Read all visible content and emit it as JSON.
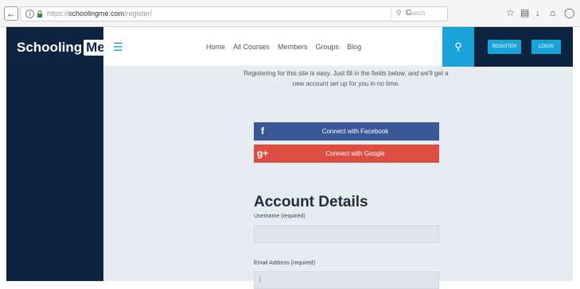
{
  "browser": {
    "back_icon": "back-arrow-icon",
    "url_protocol": "https://",
    "url_host": "schoolingme.com",
    "url_path": "/register/",
    "search_placeholder": "Search",
    "toolbar_icons": [
      "star-icon",
      "clipboard-icon",
      "download-icon",
      "home-icon",
      "shield-icon"
    ]
  },
  "site": {
    "logo_text": "Schooling",
    "logo_badge": "Me",
    "menu": [
      "Home",
      "All Courses",
      "Members",
      "Groups",
      "Blog"
    ],
    "register_label": "REGISTER",
    "login_label": "LOGIN"
  },
  "form": {
    "intro": "Registering for this site is easy. Just fill in the fields below, and we'll get a new account set up for you in no time.",
    "facebook_label": "Connect with Facebook",
    "facebook_icon": "f",
    "google_label": "Connect with Google",
    "google_icon": "g+",
    "section_title": "Account Details",
    "username_label": "Username (required)",
    "username_value": "",
    "email_label": "Email Address (required)",
    "email_value": "|"
  },
  "colors": {
    "sidebar": "#0c2440",
    "accent": "#1aa3d9",
    "facebook": "#3a5897",
    "google": "#dc4e41",
    "content_bg": "#e7ebf2"
  }
}
